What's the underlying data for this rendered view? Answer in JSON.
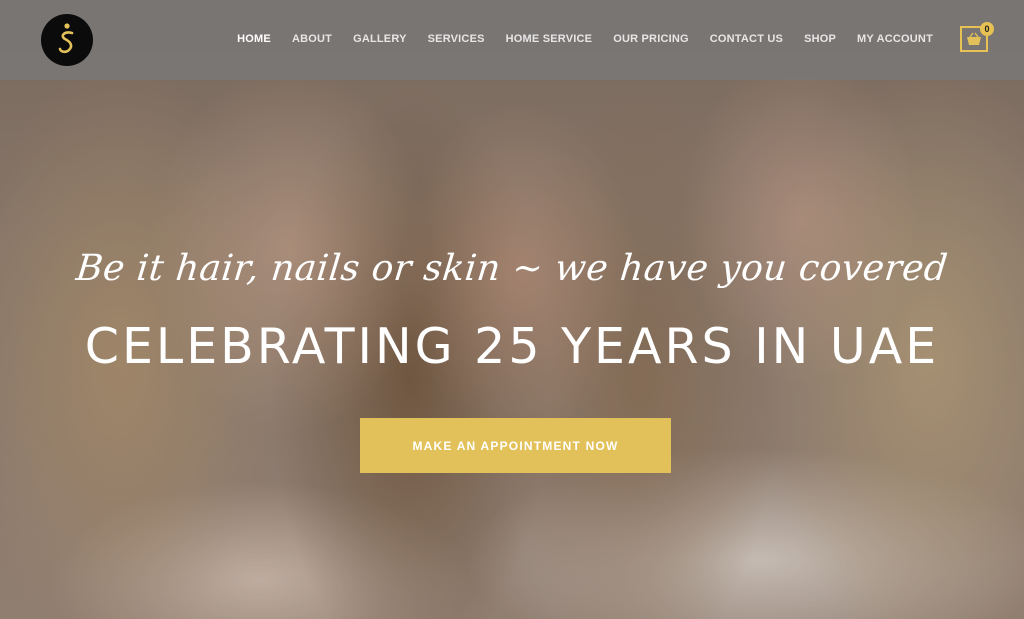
{
  "nav": {
    "items": [
      {
        "label": "HOME",
        "active": true
      },
      {
        "label": "ABOUT",
        "active": false
      },
      {
        "label": "GALLERY",
        "active": false
      },
      {
        "label": "SERVICES",
        "active": false
      },
      {
        "label": "HOME SERVICE",
        "active": false
      },
      {
        "label": "OUR PRICING",
        "active": false
      },
      {
        "label": "CONTACT US",
        "active": false
      },
      {
        "label": "SHOP",
        "active": false
      },
      {
        "label": "MY ACCOUNT",
        "active": false
      }
    ]
  },
  "cart": {
    "count": "0",
    "icon": "shopping-basket-icon"
  },
  "logo": {
    "icon": "salon-logo-icon"
  },
  "hero": {
    "tagline": "Be it hair, nails or skin ~ we have you covered",
    "headline": "CELEBRATING 25 YEARS IN UAE",
    "cta_label": "MAKE AN APPOINTMENT NOW"
  },
  "colors": {
    "accent": "#e3c15a",
    "header_bg": "#7a7a7a",
    "logo_bg": "#0b0b0b"
  }
}
